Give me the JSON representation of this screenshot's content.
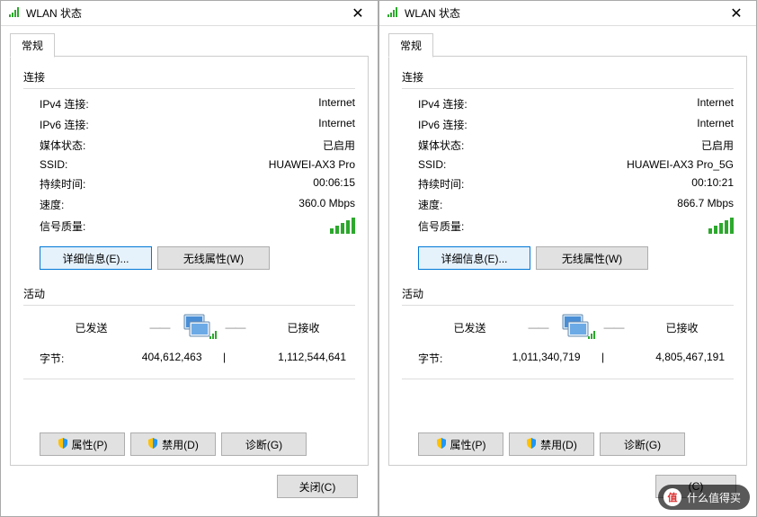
{
  "dialogs": [
    {
      "title": "WLAN 状态",
      "tab": "常规",
      "section_conn": "连接",
      "conn": [
        {
          "k": "IPv4 连接:",
          "v": "Internet"
        },
        {
          "k": "IPv6 连接:",
          "v": "Internet"
        },
        {
          "k": "媒体状态:",
          "v": "已启用"
        },
        {
          "k": "SSID:",
          "v": "HUAWEI-AX3 Pro"
        },
        {
          "k": "持续时间:",
          "v": "00:06:15"
        },
        {
          "k": "速度:",
          "v": "360.0 Mbps"
        }
      ],
      "signal_label": "信号质量:",
      "btn_details": "详细信息(E)...",
      "btn_wireless": "无线属性(W)",
      "section_act": "活动",
      "act": {
        "sent_label": "已发送",
        "recv_label": "已接收",
        "bytes_label": "字节:",
        "sent": "404,612,463",
        "recv": "1,112,544,641"
      },
      "btn_props": "属性(P)",
      "btn_disable": "禁用(D)",
      "btn_diag": "诊断(G)",
      "btn_close": "关闭(C)"
    },
    {
      "title": "WLAN 状态",
      "tab": "常规",
      "section_conn": "连接",
      "conn": [
        {
          "k": "IPv4 连接:",
          "v": "Internet"
        },
        {
          "k": "IPv6 连接:",
          "v": "Internet"
        },
        {
          "k": "媒体状态:",
          "v": "已启用"
        },
        {
          "k": "SSID:",
          "v": "HUAWEI-AX3 Pro_5G"
        },
        {
          "k": "持续时间:",
          "v": "00:10:21"
        },
        {
          "k": "速度:",
          "v": "866.7 Mbps"
        }
      ],
      "signal_label": "信号质量:",
      "btn_details": "详细信息(E)...",
      "btn_wireless": "无线属性(W)",
      "section_act": "活动",
      "act": {
        "sent_label": "已发送",
        "recv_label": "已接收",
        "bytes_label": "字节:",
        "sent": "1,011,340,719",
        "recv": "4,805,467,191"
      },
      "btn_props": "属性(P)",
      "btn_disable": "禁用(D)",
      "btn_diag": "诊断(G)",
      "btn_close": "(C)"
    }
  ],
  "watermark": "什么值得买"
}
